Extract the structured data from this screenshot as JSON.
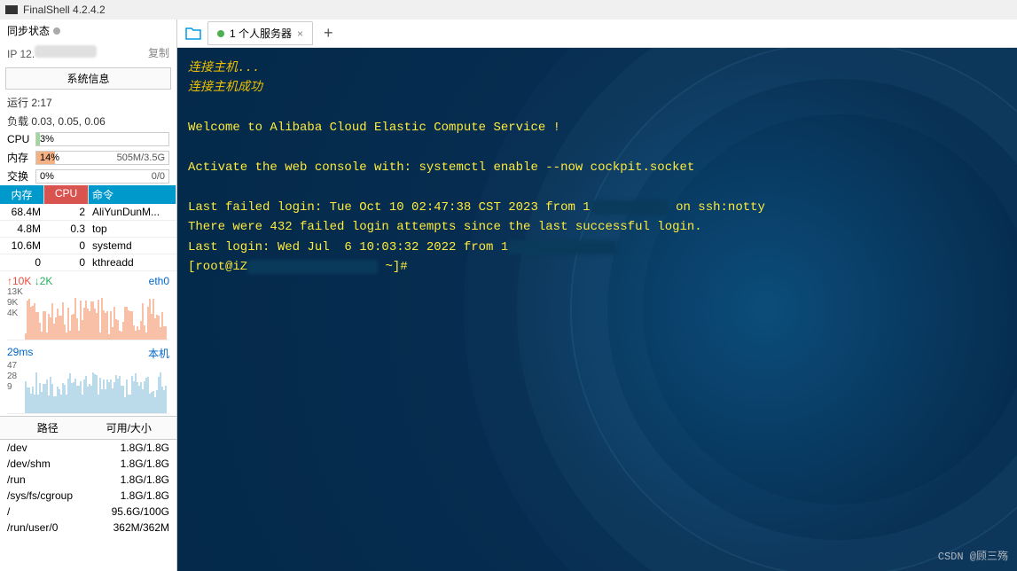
{
  "titlebar": {
    "title": "FinalShell 4.2.4.2"
  },
  "sidebar": {
    "sync_label": "同步状态",
    "ip_label": "IP",
    "ip_value": "12.",
    "copy_label": "复制",
    "sysinfo_btn": "系统信息",
    "runtime": "运行 2:17",
    "load": "负载 0.03, 0.05, 0.06",
    "cpu_label": "CPU",
    "cpu_pct": "3%",
    "mem_label": "内存",
    "mem_pct": "14%",
    "mem_right": "505M/3.5G",
    "swap_label": "交换",
    "swap_pct": "0%",
    "swap_right": "0/0",
    "proc_headers": {
      "mem": "内存",
      "cpu": "CPU",
      "cmd": "命令"
    },
    "processes": [
      {
        "mem": "68.4M",
        "cpu": "2",
        "name": "AliYunDunM..."
      },
      {
        "mem": "4.8M",
        "cpu": "0.3",
        "name": "top"
      },
      {
        "mem": "10.6M",
        "cpu": "0",
        "name": "systemd"
      },
      {
        "mem": "0",
        "cpu": "0",
        "name": "kthreadd"
      }
    ],
    "net_chart": {
      "up": "↑10K",
      "down": "↓2K",
      "iface": "eth0",
      "ylabels": [
        "13K",
        "9K",
        "4K"
      ]
    },
    "ping_chart": {
      "latency": "29ms",
      "label": "本机",
      "ylabels": [
        "47",
        "28",
        "9"
      ]
    },
    "disk_headers": {
      "path": "路径",
      "size": "可用/大小"
    },
    "disks": [
      {
        "path": "/dev",
        "size": "1.8G/1.8G"
      },
      {
        "path": "/dev/shm",
        "size": "1.8G/1.8G"
      },
      {
        "path": "/run",
        "size": "1.8G/1.8G"
      },
      {
        "path": "/sys/fs/cgroup",
        "size": "1.8G/1.8G"
      },
      {
        "path": "/",
        "size": "95.6G/100G"
      },
      {
        "path": "/run/user/0",
        "size": "362M/362M"
      }
    ]
  },
  "tabs": {
    "tab1_label": "1 个人服务器"
  },
  "terminal": {
    "l1": "连接主机...",
    "l2": "连接主机成功",
    "l3": "Welcome to Alibaba Cloud Elastic Compute Service !",
    "l4": "Activate the web console with: systemctl enable --now cockpit.socket",
    "l5a": "Last failed login: Tue Oct 10 02:47:38 CST 2023 from 1",
    "l5b": " on ssh:notty",
    "l6": "There were 432 failed login attempts since the last successful login.",
    "l7a": "Last login: Wed Jul  6 10:03:32 2022 from 1",
    "l8a": "[root@iZ",
    "l8b": " ~]#"
  },
  "watermark": "CSDN @顾三殇"
}
